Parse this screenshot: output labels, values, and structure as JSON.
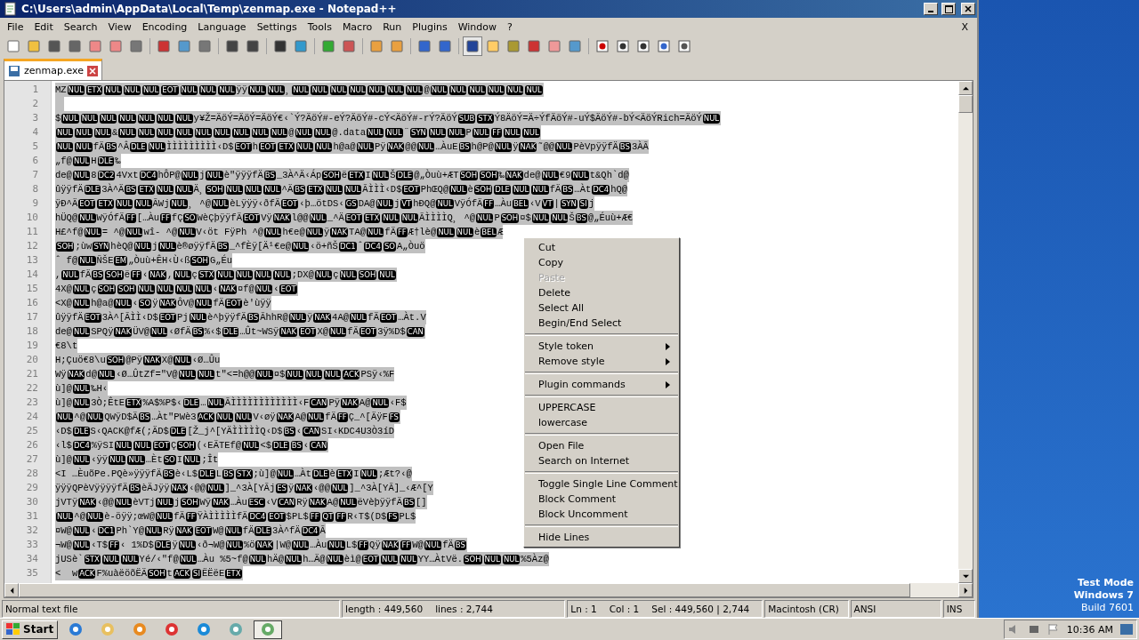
{
  "window": {
    "title": "C:\\Users\\admin\\AppData\\Local\\Temp\\zenmap.exe - Notepad++"
  },
  "menu": [
    "File",
    "Edit",
    "Search",
    "View",
    "Encoding",
    "Language",
    "Settings",
    "Tools",
    "Macro",
    "Run",
    "Plugins",
    "Window",
    "?"
  ],
  "menu_close": "X",
  "toolbar": [
    {
      "pressed": false
    },
    {
      "pressed": false
    },
    {
      "pressed": false
    },
    {
      "pressed": false
    },
    {
      "pressed": false
    },
    {
      "pressed": false
    },
    {
      "pressed": false
    },
    {
      "pressed": false
    },
    {
      "pressed": false
    },
    {
      "pressed": false
    },
    {
      "pressed": false
    },
    {
      "pressed": false
    },
    {
      "pressed": false
    },
    {
      "pressed": false
    },
    {
      "pressed": false
    },
    {
      "pressed": false
    },
    {
      "pressed": false
    },
    {
      "pressed": false
    },
    {
      "pressed": false
    },
    {
      "pressed": false
    },
    {
      "pressed": true
    },
    {
      "pressed": false
    },
    {
      "pressed": false
    },
    {
      "pressed": false
    },
    {
      "pressed": false
    },
    {
      "pressed": false
    },
    {
      "pressed": false
    },
    {
      "pressed": false
    },
    {
      "pressed": false
    },
    {
      "pressed": false
    },
    {
      "pressed": false
    }
  ],
  "tabs": [
    {
      "label": "zenmap.exe",
      "selected": true
    }
  ],
  "editor": {
    "line_numbers": [
      "1",
      "2",
      "3",
      "4",
      "5",
      "6",
      "7",
      "8",
      "9",
      "10",
      "11",
      "12",
      "13",
      "14",
      "15",
      "16",
      "17",
      "18",
      "19",
      "20",
      "21",
      "22",
      "23",
      "24",
      "25",
      "26",
      "27",
      "28",
      "29",
      "30",
      "31",
      "32",
      "33",
      "34",
      "35"
    ],
    "lines": [
      [
        {
          "t": "MZ"
        },
        {
          "c": "NUL"
        },
        {
          "c": "ETX"
        },
        {
          "c": "NUL"
        },
        {
          "c": "NUL"
        },
        {
          "c": "NUL"
        },
        {
          "c": "EOT"
        },
        {
          "c": "NUL"
        },
        {
          "c": "NUL"
        },
        {
          "c": "NUL"
        },
        {
          "t": "ÿÿ"
        },
        {
          "c": "NUL"
        },
        {
          "c": "NUL"
        },
        {
          "t": "¸"
        },
        {
          "c": "NUL"
        },
        {
          "c": "NUL"
        },
        {
          "c": "NUL"
        },
        {
          "c": "NUL"
        },
        {
          "c": "NUL"
        },
        {
          "c": "NUL"
        },
        {
          "c": "NUL"
        },
        {
          "t": "@"
        },
        {
          "c": "NUL"
        },
        {
          "c": "NUL"
        },
        {
          "c": "NUL"
        },
        {
          "c": "NUL"
        },
        {
          "c": "NUL"
        },
        {
          "c": "NUL"
        }
      ],
      {
        "kind": "blank"
      },
      [
        {
          "t": "$"
        },
        {
          "c": "NUL"
        },
        {
          "c": "NUL"
        },
        {
          "c": "NUL"
        },
        {
          "c": "NUL"
        },
        {
          "c": "NUL"
        },
        {
          "c": "NUL"
        },
        {
          "c": "NUL"
        },
        {
          "t": "y¥Ž=ÄöÝ=ÄöÝ=ÄöÝ€‹`Ý?ÄöÝ#-eÝ?ÄöÝ#-cÝ<ÄöÝ#-rÝ?ÄöÝ"
        },
        {
          "c": "SUB"
        },
        {
          "c": "STX"
        },
        {
          "t": "Ý8ÄöÝ=Ä÷ÝfÄöÝ#-uÝ$ÄöÝ#-bÝ<ÄöÝRich=ÄöÝ"
        },
        {
          "c": "NUL"
        }
      ],
      [
        {
          "c": "NUL"
        },
        {
          "c": "NUL"
        },
        {
          "c": "NUL"
        },
        {
          "t": "&"
        },
        {
          "c": "NUL"
        },
        {
          "c": "NUL"
        },
        {
          "c": "NUL"
        },
        {
          "c": "NUL"
        },
        {
          "c": "NUL"
        },
        {
          "c": "NUL"
        },
        {
          "c": "NUL"
        },
        {
          "c": "NUL"
        },
        {
          "c": "NUL"
        },
        {
          "t": "@"
        },
        {
          "c": "NUL"
        },
        {
          "c": "NUL"
        },
        {
          "t": "@.data"
        },
        {
          "c": "NUL"
        },
        {
          "c": "NUL"
        },
        {
          "t": "¨"
        },
        {
          "c": "SYN"
        },
        {
          "c": "NUL"
        },
        {
          "c": "NUL"
        },
        {
          "t": "P"
        },
        {
          "c": "NUL"
        },
        {
          "c": "FF"
        },
        {
          "c": "NUL"
        },
        {
          "c": "NUL"
        }
      ],
      [
        {
          "c": "NUL"
        },
        {
          "c": "NUL"
        },
        {
          "t": "fÄ"
        },
        {
          "c": "BS"
        },
        {
          "t": "^Â"
        },
        {
          "c": "DLE"
        },
        {
          "c": "NUL"
        },
        {
          "t": "ÌÌÌÌÌÌÌÌÌ‹D$"
        },
        {
          "c": "EOT"
        },
        {
          "t": "h"
        },
        {
          "c": "EOT"
        },
        {
          "c": "ETX"
        },
        {
          "c": "NUL"
        },
        {
          "c": "NUL"
        },
        {
          "t": "h@a@"
        },
        {
          "c": "NUL"
        },
        {
          "t": "Pÿ"
        },
        {
          "c": "NAK"
        },
        {
          "t": "@@"
        },
        {
          "c": "NUL"
        },
        {
          "t": "…ÀuE"
        },
        {
          "c": "BS"
        },
        {
          "t": "h@P@"
        },
        {
          "c": "NUL"
        },
        {
          "t": "ÿ"
        },
        {
          "c": "NAK"
        },
        {
          "t": "˜@@"
        },
        {
          "c": "NUL"
        },
        {
          "t": "PèVpÿÿfÄ"
        },
        {
          "c": "BS"
        },
        {
          "t": "3ÀÃ"
        }
      ],
      [
        {
          "t": "„f@"
        },
        {
          "c": "NUL"
        },
        {
          "t": "H"
        },
        {
          "c": "DLE"
        },
        {
          "t": "‰"
        }
      ],
      [
        {
          "t": "de@"
        },
        {
          "c": "NUL"
        },
        {
          "t": "8"
        },
        {
          "c": "DC2"
        },
        {
          "t": "4Vxt"
        },
        {
          "c": "DC4"
        },
        {
          "t": "hÔP@"
        },
        {
          "c": "NUL"
        },
        {
          "t": "j"
        },
        {
          "c": "NUL"
        },
        {
          "t": "è\"ÿÿÿfÄ"
        },
        {
          "c": "BS"
        },
        {
          "t": "_3À^Ä‹Áp"
        },
        {
          "c": "SOH"
        },
        {
          "t": "ë"
        },
        {
          "c": "ETX"
        },
        {
          "t": "I"
        },
        {
          "c": "NUL"
        },
        {
          "t": "Š"
        },
        {
          "c": "DLE"
        },
        {
          "t": "@„Òuù+ÆT"
        },
        {
          "c": "SOH"
        },
        {
          "c": "SOH"
        },
        {
          "t": "‰"
        },
        {
          "c": "NAK"
        },
        {
          "t": "de@"
        },
        {
          "c": "NUL"
        },
        {
          "t": "€9"
        },
        {
          "c": "NUL"
        },
        {
          "t": "t&Qh`d@"
        }
      ],
      [
        {
          "t": "ûÿÿfÄ"
        },
        {
          "c": "DLE"
        },
        {
          "t": "3À^Ä"
        },
        {
          "c": "BS"
        },
        {
          "c": "ETX"
        },
        {
          "c": "NUL"
        },
        {
          "c": "NUL"
        },
        {
          "t": "Ä¸"
        },
        {
          "c": "SOH"
        },
        {
          "c": "NUL"
        },
        {
          "c": "NUL"
        },
        {
          "c": "NUL"
        },
        {
          "t": "^Ä"
        },
        {
          "c": "BS"
        },
        {
          "c": "ETX"
        },
        {
          "c": "NUL"
        },
        {
          "c": "NUL"
        },
        {
          "t": "ÃÌÌÌ‹D$"
        },
        {
          "c": "EOT"
        },
        {
          "t": "PhŒQ@"
        },
        {
          "c": "NUL"
        },
        {
          "t": "è"
        },
        {
          "c": "SOH"
        },
        {
          "c": "DLE"
        },
        {
          "c": "NUL"
        },
        {
          "c": "NUL"
        },
        {
          "t": "fÄ"
        },
        {
          "c": "BS"
        },
        {
          "t": "…Àt"
        },
        {
          "c": "DC4"
        },
        {
          "t": "hQ@"
        }
      ],
      [
        {
          "t": "ÿÐ^Ä"
        },
        {
          "c": "EOT"
        },
        {
          "c": "ETX"
        },
        {
          "c": "NUL"
        },
        {
          "c": "NUL"
        },
        {
          "t": "ÃWj"
        },
        {
          "c": "NUL"
        },
        {
          "t": "¸ ^@"
        },
        {
          "c": "NUL"
        },
        {
          "t": "èLÿÿÿ‹ðfÄ"
        },
        {
          "c": "EOT"
        },
        {
          "t": "‹þ…ötDS‹"
        },
        {
          "c": "GS"
        },
        {
          "t": "DA@"
        },
        {
          "c": "NUL"
        },
        {
          "t": "j"
        },
        {
          "c": "VT"
        },
        {
          "t": "hÐQ@"
        },
        {
          "c": "NUL"
        },
        {
          "t": "VÿÓfÄ"
        },
        {
          "c": "FF"
        },
        {
          "t": "…Àu"
        },
        {
          "c": "BEL"
        },
        {
          "t": "‹V"
        },
        {
          "c": "VT"
        },
        {
          "t": "|"
        },
        {
          "c": "SYN"
        },
        {
          "c": "SI"
        },
        {
          "t": "j"
        }
      ],
      [
        {
          "t": "hÜQ@"
        },
        {
          "c": "NUL"
        },
        {
          "t": "WÿÓfÄ"
        },
        {
          "c": "FF"
        },
        {
          "t": "[…Àu"
        },
        {
          "c": "FF"
        },
        {
          "t": "fÇ"
        },
        {
          "c": "SO"
        },
        {
          "t": "WèÇþÿÿfÄ"
        },
        {
          "c": "EOT"
        },
        {
          "t": "Vÿ"
        },
        {
          "c": "NAK"
        },
        {
          "t": "l@@"
        },
        {
          "c": "NUL"
        },
        {
          "t": "_^Ä"
        },
        {
          "c": "EOT"
        },
        {
          "c": "ETX"
        },
        {
          "c": "NUL"
        },
        {
          "c": "NUL"
        },
        {
          "t": "ÃÌÌÌÌQ¸ ^@"
        },
        {
          "c": "NUL"
        },
        {
          "t": "P"
        },
        {
          "c": "SOH"
        },
        {
          "t": "¤$"
        },
        {
          "c": "NUL"
        },
        {
          "c": "NUL"
        },
        {
          "t": "Š"
        },
        {
          "c": "BS"
        },
        {
          "t": "@„Éuù+Æ€"
        }
      ],
      [
        {
          "t": "H£^f@"
        },
        {
          "c": "NUL"
        },
        {
          "t": "= ^@"
        },
        {
          "c": "NUL"
        },
        {
          "t": "wî- ^@"
        },
        {
          "c": "NUL"
        },
        {
          "t": "V‹öt FÿPh ^@"
        },
        {
          "c": "NUL"
        },
        {
          "t": "h€e@"
        },
        {
          "c": "NUL"
        },
        {
          "t": "ÿ"
        },
        {
          "c": "NAK"
        },
        {
          "t": "TA@"
        },
        {
          "c": "NUL"
        },
        {
          "t": "fÄ"
        },
        {
          "c": "FF"
        },
        {
          "t": "Æ†lè@"
        },
        {
          "c": "NUL"
        },
        {
          "c": "NUL"
        },
        {
          "t": "è"
        },
        {
          "c": "BEL"
        },
        {
          "t": "Æ"
        }
      ],
      [
        {
          "c": "SOH"
        },
        {
          "t": ";ùw"
        },
        {
          "c": "SYN"
        },
        {
          "t": "hèQ@"
        },
        {
          "c": "NUL"
        },
        {
          "t": "j"
        },
        {
          "c": "NUL"
        },
        {
          "t": "è®øÿÿfÄ"
        },
        {
          "c": "BS"
        },
        {
          "t": "_^fÈÿ[Ä¹€e@"
        },
        {
          "c": "NUL"
        },
        {
          "t": "‹ö+ñŠ"
        },
        {
          "c": "DC1"
        },
        {
          "t": "ˆ"
        },
        {
          "c": "DC4"
        },
        {
          "c": "SO"
        },
        {
          "t": "A„Òuö"
        }
      ],
      [
        {
          "t": "ˆ f@"
        },
        {
          "c": "NUL"
        },
        {
          "t": "ÑŠE"
        },
        {
          "c": "EM"
        },
        {
          "t": "„Òuù+ÊH‹Ù‹ß"
        },
        {
          "c": "SOH"
        },
        {
          "t": "G„Éu"
        }
      ],
      [
        {
          "t": ","
        },
        {
          "c": "NUL"
        },
        {
          "t": "fÄ"
        },
        {
          "c": "BS"
        },
        {
          "c": "SOH"
        },
        {
          "t": "ë"
        },
        {
          "c": "FF"
        },
        {
          "t": "‹"
        },
        {
          "c": "NAK"
        },
        {
          "t": ","
        },
        {
          "c": "NUL"
        },
        {
          "t": "ç"
        },
        {
          "c": "STX"
        },
        {
          "c": "NUL"
        },
        {
          "c": "NUL"
        },
        {
          "c": "NUL"
        },
        {
          "c": "NUL"
        },
        {
          "t": ";DX@"
        },
        {
          "c": "NUL"
        },
        {
          "t": "ç"
        },
        {
          "c": "NUL"
        },
        {
          "c": "SOH"
        },
        {
          "c": "NUL"
        }
      ],
      [
        {
          "t": "4X@"
        },
        {
          "c": "NUL"
        },
        {
          "t": "ç"
        },
        {
          "c": "SOH"
        },
        {
          "c": "SOH"
        },
        {
          "c": "NUL"
        },
        {
          "c": "NUL"
        },
        {
          "c": "NUL"
        },
        {
          "c": "NUL"
        },
        {
          "t": "‹"
        },
        {
          "c": "NAK"
        },
        {
          "t": "¤f@"
        },
        {
          "c": "NUL"
        },
        {
          "t": "‹"
        },
        {
          "c": "EOT"
        }
      ],
      [
        {
          "t": "<X@"
        },
        {
          "c": "NUL"
        },
        {
          "t": "h@a@"
        },
        {
          "c": "NUL"
        },
        {
          "t": "‹"
        },
        {
          "c": "SO"
        },
        {
          "t": "ÿ"
        },
        {
          "c": "NAK"
        },
        {
          "t": "ÔV@"
        },
        {
          "c": "NUL"
        },
        {
          "t": "fÄ"
        },
        {
          "c": "EOT"
        },
        {
          "t": "è'ùÿÿ"
        }
      ],
      [
        {
          "t": "ûÿÿfÄ"
        },
        {
          "c": "EOT"
        },
        {
          "t": "3À^[ÃÌÌ‹D$"
        },
        {
          "c": "EOT"
        },
        {
          "t": "Pj"
        },
        {
          "c": "NUL"
        },
        {
          "t": "è^þÿÿfÄ"
        },
        {
          "c": "BS"
        },
        {
          "t": "ÃhhR@"
        },
        {
          "c": "NUL"
        },
        {
          "t": "ÿ"
        },
        {
          "c": "NAK"
        },
        {
          "t": "4A@"
        },
        {
          "c": "NUL"
        },
        {
          "t": "fÄ"
        },
        {
          "c": "EOT"
        },
        {
          "t": "…Àt.V"
        }
      ],
      [
        {
          "t": "de@"
        },
        {
          "c": "NUL"
        },
        {
          "t": "SPQÿ"
        },
        {
          "c": "NAK"
        },
        {
          "t": "ÜV@"
        },
        {
          "c": "NUL"
        },
        {
          "t": "‹ØfÄ"
        },
        {
          "c": "BS"
        },
        {
          "t": "%‹$"
        },
        {
          "c": "DLE"
        },
        {
          "t": "…Ût~WSÿ"
        },
        {
          "c": "NAK"
        },
        {
          "c": "EOT"
        },
        {
          "t": "X@"
        },
        {
          "c": "NUL"
        },
        {
          "t": "fÄ"
        },
        {
          "c": "EOT"
        },
        {
          "t": "3ÿ%D$"
        },
        {
          "c": "CAN"
        }
      ],
      [
        {
          "t": "€8\\t"
        }
      ],
      [
        {
          "t": "H;Çuö€8\\u"
        },
        {
          "c": "SOH"
        },
        {
          "t": "@Pÿ"
        },
        {
          "c": "NAK"
        },
        {
          "t": "X@"
        },
        {
          "c": "NUL"
        },
        {
          "t": "‹Ø…Ûu"
        }
      ],
      [
        {
          "t": "Wÿ"
        },
        {
          "c": "NAK"
        },
        {
          "t": "d@"
        },
        {
          "c": "NUL"
        },
        {
          "t": "‹Ø…ÛtZf=\"V@"
        },
        {
          "c": "NUL"
        },
        {
          "c": "NUL"
        },
        {
          "t": "t\"<=h@@"
        },
        {
          "c": "NUL"
        },
        {
          "t": "¤$"
        },
        {
          "c": "NUL"
        },
        {
          "c": "NUL"
        },
        {
          "c": "NUL"
        },
        {
          "c": "ACK"
        },
        {
          "t": "PSÿ‹%F"
        }
      ],
      [
        {
          "t": "ù]@"
        },
        {
          "c": "NUL"
        },
        {
          "t": "‰H‹"
        }
      ],
      [
        {
          "t": "ù]@"
        },
        {
          "c": "NUL"
        },
        {
          "t": "3Ò;ÊtE"
        },
        {
          "c": "ETX"
        },
        {
          "t": "%A$%P$‹"
        },
        {
          "c": "DLE"
        },
        {
          "t": "…"
        },
        {
          "c": "NUL"
        },
        {
          "t": "ÃÌÌÌÌÌÌÌÌÌÌÌÌ‹F"
        },
        {
          "c": "CAN"
        },
        {
          "t": "Pÿ"
        },
        {
          "c": "NAK"
        },
        {
          "t": "A@"
        },
        {
          "c": "NUL"
        },
        {
          "t": "‹F$"
        }
      ],
      [
        {
          "c": "NUL"
        },
        {
          "t": "^@"
        },
        {
          "c": "NUL"
        },
        {
          "t": "QWÿD$Ä"
        },
        {
          "c": "BS"
        },
        {
          "t": "…Àt\"PWè3"
        },
        {
          "c": "ACK"
        },
        {
          "c": "NUL"
        },
        {
          "c": "NUL"
        },
        {
          "t": "V‹øÿ"
        },
        {
          "c": "NAK"
        },
        {
          "t": "A@"
        },
        {
          "c": "NUL"
        },
        {
          "t": "fÄ"
        },
        {
          "c": "FF"
        },
        {
          "t": "Ç_^[ÄÿF"
        },
        {
          "c": "FS"
        }
      ],
      [
        {
          "t": "‹D$"
        },
        {
          "c": "DLE"
        },
        {
          "t": "S"
        },
        {
          "t": "‹QACK@fÆ(;Ä"
        },
        {
          "t": "D$"
        },
        {
          "c": "DLE"
        },
        {
          "t": "[Ž_j^[YÄÌÌÌÌÌQ‹D$"
        },
        {
          "c": "BS"
        },
        {
          "t": "‹"
        },
        {
          "c": "CAN"
        },
        {
          "t": "SI"
        },
        {
          "t": "‹KDC4U3Ò3íD"
        }
      ],
      [
        {
          "t": "‹l$"
        },
        {
          "c": "DC4"
        },
        {
          "t": "%ÿSI"
        },
        {
          "c": "NUL"
        },
        {
          "c": "NUL"
        },
        {
          "c": "EOT"
        },
        {
          "t": "Ç"
        },
        {
          "c": "SOH"
        },
        {
          "t": "(‹EÄTEf@"
        },
        {
          "c": "NUL"
        },
        {
          "t": "<$"
        },
        {
          "c": "DLE"
        },
        {
          "c": "BS"
        },
        {
          "t": "‹"
        },
        {
          "c": "CAN"
        }
      ],
      [
        {
          "t": "ù]@"
        },
        {
          "c": "NUL"
        },
        {
          "t": "‹ÿÿ"
        },
        {
          "c": "NUL"
        },
        {
          "c": "NUL"
        },
        {
          "t": "…Èt"
        },
        {
          "c": "SO"
        },
        {
          "t": "I"
        },
        {
          "c": "NUL"
        },
        {
          "t": ";Ît"
        }
      ],
      [
        {
          "t": "<I …ÈuõPe.PQè»ÿÿÿfÄ"
        },
        {
          "c": "BS"
        },
        {
          "t": "è‹L$"
        },
        {
          "c": "DLE"
        },
        {
          "t": "L"
        },
        {
          "c": "BS"
        },
        {
          "c": "STX"
        },
        {
          "t": ";ù]@"
        },
        {
          "c": "NUL"
        },
        {
          "t": "…Àt"
        },
        {
          "c": "DLE"
        },
        {
          "t": "è"
        },
        {
          "c": "ETX"
        },
        {
          "t": "I"
        },
        {
          "c": "NUL"
        },
        {
          "t": ";Æt?‹@"
        }
      ],
      [
        {
          "t": "ÿÿÿQPèVÿÿÿÿfÄ"
        },
        {
          "c": "BS"
        },
        {
          "t": "èÄJÿÿ"
        },
        {
          "c": "NAK"
        },
        {
          "t": "‹@@"
        },
        {
          "c": "NUL"
        },
        {
          "t": "]_^3À[YÃj"
        },
        {
          "c": "ES"
        },
        {
          "t": "ÿ"
        },
        {
          "c": "NAK"
        },
        {
          "t": "‹@@"
        },
        {
          "c": "NUL"
        },
        {
          "t": "]_^3À[YÃ]_‹Æ^[Y"
        }
      ],
      [
        {
          "t": "jVTÿ"
        },
        {
          "c": "NAK"
        },
        {
          "t": "‹@@"
        },
        {
          "c": "NUL"
        },
        {
          "t": "èVTj"
        },
        {
          "c": "NUL"
        },
        {
          "t": "j"
        },
        {
          "c": "SOH"
        },
        {
          "t": "Wÿ"
        },
        {
          "c": "NAK"
        },
        {
          "t": "…Àu"
        },
        {
          "c": "ESC"
        },
        {
          "t": "‹V"
        },
        {
          "c": "CAN"
        },
        {
          "t": "Rÿ"
        },
        {
          "c": "NAK"
        },
        {
          "t": "A@"
        },
        {
          "c": "NUL"
        },
        {
          "t": "ëVèþÿÿfÄ"
        },
        {
          "c": "BS"
        },
        {
          "t": "[]"
        }
      ],
      [
        {
          "c": "NUL"
        },
        {
          "t": "^@"
        },
        {
          "c": "NUL"
        },
        {
          "t": "è-öÿÿ;œW@"
        },
        {
          "c": "NUL"
        },
        {
          "t": "fÄ"
        },
        {
          "c": "FF"
        },
        {
          "t": "ŸÀÌÌÌÌÌfÄ"
        },
        {
          "c": "DC4"
        },
        {
          "c": "EOT"
        },
        {
          "t": "$PL$"
        },
        {
          "c": "FF"
        },
        {
          "c": "QT"
        },
        {
          "c": "FF"
        },
        {
          "t": "R‹T$(D$"
        },
        {
          "c": "FS"
        },
        {
          "t": "PL$"
        }
      ],
      [
        {
          "t": "¤W@"
        },
        {
          "c": "NUL"
        },
        {
          "t": "‹"
        },
        {
          "c": "DC1"
        },
        {
          "t": "Ph`Y@"
        },
        {
          "c": "NUL"
        },
        {
          "t": "Rÿ"
        },
        {
          "c": "NAK"
        },
        {
          "c": "EOT"
        },
        {
          "t": "W@"
        },
        {
          "c": "NUL"
        },
        {
          "t": "fÄ"
        },
        {
          "c": "DLE"
        },
        {
          "t": "3À^fÄ"
        },
        {
          "c": "DC4"
        },
        {
          "t": "Ã"
        }
      ],
      [
        {
          "t": "¬W@"
        },
        {
          "c": "NUL"
        },
        {
          "t": "‹T$"
        },
        {
          "c": "FF"
        },
        {
          "t": "‹ 1%D$"
        },
        {
          "c": "DLE"
        },
        {
          "t": "ÿ"
        },
        {
          "c": "NUL"
        },
        {
          "t": "‹ð¬W@"
        },
        {
          "c": "NUL"
        },
        {
          "t": "%ö"
        },
        {
          "c": "NAK"
        },
        {
          "t": "|W@"
        },
        {
          "c": "NUL"
        },
        {
          "t": "…Àu"
        },
        {
          "c": "NUL"
        },
        {
          "t": "L$"
        },
        {
          "c": "FF"
        },
        {
          "t": "Qÿ"
        },
        {
          "c": "NAK"
        },
        {
          "c": "FF"
        },
        {
          "t": "W@"
        },
        {
          "c": "NUL"
        },
        {
          "t": "fÄ"
        },
        {
          "c": "BS"
        }
      ],
      [
        {
          "t": "jUSè`"
        },
        {
          "c": "STX"
        },
        {
          "c": "NUL"
        },
        {
          "c": "NUL"
        },
        {
          "t": "Yé/‹\"f@"
        },
        {
          "c": "NUL"
        },
        {
          "t": "…Àu %5~f@"
        },
        {
          "c": "NUL"
        },
        {
          "t": "hÄ@"
        },
        {
          "c": "NUL"
        },
        {
          "t": "h…Ä@"
        },
        {
          "c": "NUL"
        },
        {
          "t": "èì@"
        },
        {
          "c": "EOT"
        },
        {
          "c": "NUL"
        },
        {
          "c": "NUL"
        },
        {
          "t": "YY…ÀtVë."
        },
        {
          "c": "SOH"
        },
        {
          "c": "NUL"
        },
        {
          "c": "NUL"
        },
        {
          "t": "%5Àz@"
        }
      ],
      [
        {
          "t": "<  w"
        },
        {
          "c": "ACK"
        },
        {
          "t": "F%uàëöõËÄ"
        },
        {
          "c": "SOH"
        },
        {
          "t": "t"
        },
        {
          "c": "ACK"
        },
        {
          "c": "SI"
        },
        {
          "t": "ËËëE"
        },
        {
          "c": "ETX"
        }
      ]
    ]
  },
  "context_menu": [
    {
      "kind": "item",
      "label": "Cut",
      "disabled": false
    },
    {
      "kind": "item",
      "label": "Copy",
      "disabled": false
    },
    {
      "kind": "item",
      "label": "Paste",
      "disabled": true
    },
    {
      "kind": "item",
      "label": "Delete",
      "disabled": false
    },
    {
      "kind": "item",
      "label": "Select All",
      "disabled": false
    },
    {
      "kind": "item",
      "label": "Begin/End Select",
      "disabled": false
    },
    {
      "kind": "separator"
    },
    {
      "kind": "submenu",
      "label": "Style token",
      "disabled": false
    },
    {
      "kind": "submenu",
      "label": "Remove style",
      "disabled": false
    },
    {
      "kind": "separator"
    },
    {
      "kind": "submenu",
      "label": "Plugin commands",
      "disabled": false
    },
    {
      "kind": "separator"
    },
    {
      "kind": "item",
      "label": "UPPERCASE",
      "disabled": false
    },
    {
      "kind": "item",
      "label": "lowercase",
      "disabled": false
    },
    {
      "kind": "separator"
    },
    {
      "kind": "item",
      "label": "Open File",
      "disabled": false
    },
    {
      "kind": "item",
      "label": "Search on Internet",
      "disabled": false
    },
    {
      "kind": "separator"
    },
    {
      "kind": "item",
      "label": "Toggle Single Line Comment",
      "disabled": false
    },
    {
      "kind": "item",
      "label": "Block Comment",
      "disabled": false
    },
    {
      "kind": "item",
      "label": "Block Uncomment",
      "disabled": false
    },
    {
      "kind": "separator"
    },
    {
      "kind": "item",
      "label": "Hide Lines",
      "disabled": false
    }
  ],
  "status_bar": {
    "file_type": "Normal text file",
    "length": "length : 449,560",
    "lines": "lines : 2,744",
    "ln": "Ln : 1",
    "col": "Col : 1",
    "sel": "Sel : 449,560 | 2,744",
    "eol": "Macintosh (CR)",
    "encoding": "ANSI",
    "mode": "INS"
  },
  "desktop": {
    "watermark_lines": [
      "Test Mode",
      "Windows 7",
      "Build 7601"
    ]
  },
  "taskbar": {
    "start": "Start",
    "apps": [
      {
        "selected": false
      },
      {
        "selected": false
      },
      {
        "selected": false
      },
      {
        "selected": false
      },
      {
        "selected": false
      },
      {
        "selected": false
      },
      {
        "selected": true
      }
    ],
    "clock": "10:36 AM"
  }
}
